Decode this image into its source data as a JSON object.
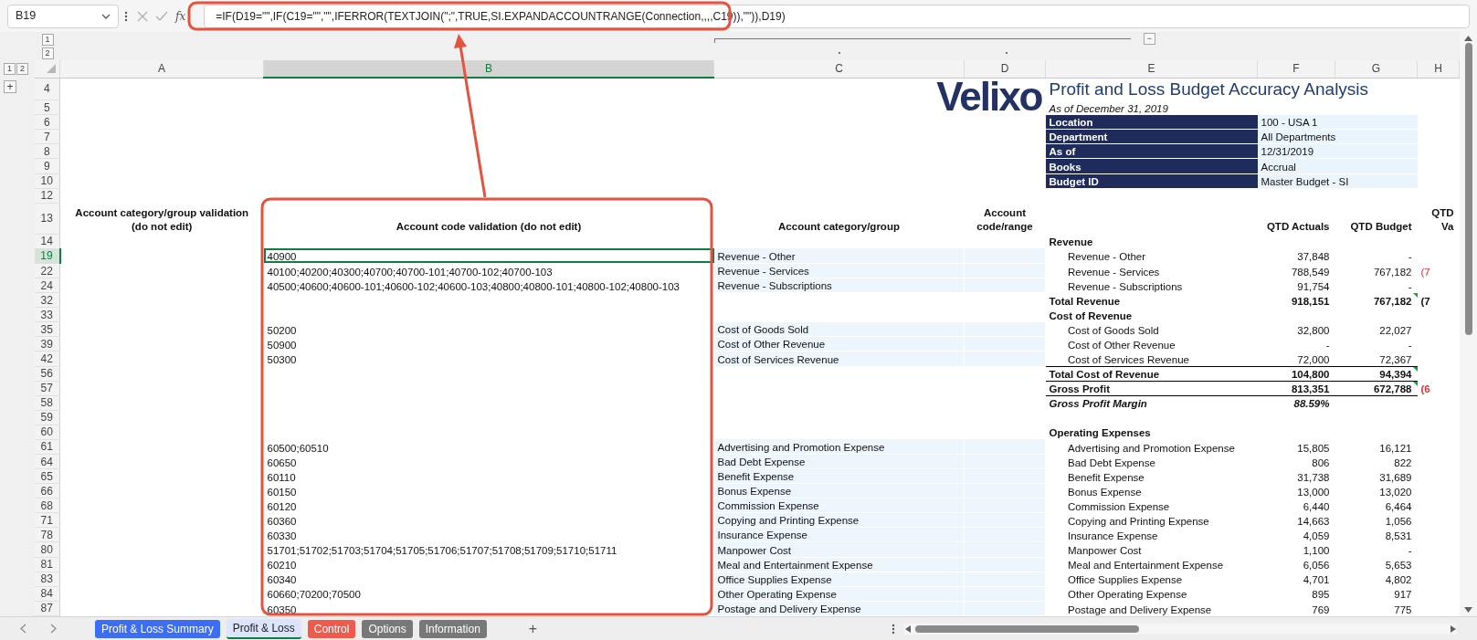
{
  "formula_bar": {
    "cell_ref": "B19",
    "function_label": "fx",
    "formula": "=IF(D19=\"\",IF(C19=\"\",\"\",IFERROR(TEXTJOIN(\";\",TRUE,SI.EXPANDACCOUNTRANGE(Connection,,,,C19)),\"\")),D19)"
  },
  "outline": {
    "column_levels": [
      "1",
      "2"
    ],
    "collapse": "−",
    "row_levels": [
      "1",
      "2"
    ],
    "expand": "+"
  },
  "columns": [
    {
      "label": "A",
      "selected": false
    },
    {
      "label": "B",
      "selected": true
    },
    {
      "label": "C",
      "selected": false
    },
    {
      "label": "D",
      "selected": false
    },
    {
      "label": "E",
      "selected": false
    },
    {
      "label": "F",
      "selected": false
    },
    {
      "label": "G",
      "selected": false
    },
    {
      "label": "H",
      "selected": false
    }
  ],
  "rows": [
    {
      "n": "4",
      "selected": false,
      "flagged": false,
      "logo": "Velixo",
      "title": "Profit and Loss Budget Accuracy Analysis"
    },
    {
      "n": "5",
      "selected": false,
      "flagged": false,
      "subtitle": "As of December 31, 2019"
    },
    {
      "n": "6",
      "selected": false,
      "flagged": false,
      "param_label": "Location",
      "param_value": "100 - USA 1"
    },
    {
      "n": "7",
      "selected": false,
      "flagged": false,
      "param_label": "Department",
      "param_value": "All Departments"
    },
    {
      "n": "8",
      "selected": false,
      "flagged": false,
      "param_label": "As of",
      "param_value": "12/31/2019"
    },
    {
      "n": "9",
      "selected": false,
      "flagged": false,
      "param_label": "Books",
      "param_value": "Accrual"
    },
    {
      "n": "10",
      "selected": false,
      "flagged": false,
      "param_label": "Budget ID",
      "param_value": "Master Budget - SI"
    },
    {
      "n": "12",
      "selected": false,
      "flagged": false
    },
    {
      "n": "13",
      "selected": false,
      "flagged": false,
      "kind": "column-header",
      "a": "Account category/group validation (do not edit)",
      "b": "Account code validation\n(do not edit)",
      "c": "Account category/group",
      "d": "Account code/range",
      "f": "QTD Actuals",
      "g": "QTD Budget",
      "h": "QTD Va"
    },
    {
      "n": "14",
      "selected": false,
      "flagged": false,
      "kind": "section",
      "e": "Revenue"
    },
    {
      "n": "19",
      "selected": true,
      "flagged": false,
      "kind": "item",
      "b": "40900",
      "c": "Revenue - Other",
      "e": "Revenue - Other",
      "f": "37,848",
      "g": "-"
    },
    {
      "n": "22",
      "selected": false,
      "flagged": false,
      "kind": "item",
      "b": "40100;40200;40300;40700;40700-101;40700-102;40700-103",
      "c": "Revenue - Services",
      "e": "Revenue - Services",
      "f": "788,549",
      "g": "767,182",
      "h": "(7",
      "alert": true
    },
    {
      "n": "24",
      "selected": false,
      "flagged": false,
      "kind": "item",
      "b": "40500;40600;40600-101;40600-102;40600-103;40800;40800-101;40800-102;40800-103",
      "c": "Revenue - Subscriptions",
      "e": "Revenue - Subscriptions",
      "f": "91,754",
      "g": "-"
    },
    {
      "n": "32",
      "selected": false,
      "flagged": true,
      "kind": "total",
      "e": "Total Revenue",
      "f": "918,151",
      "g": "767,182",
      "h": "(7",
      "alert": false
    },
    {
      "n": "33",
      "selected": false,
      "flagged": false,
      "kind": "section",
      "e": "Cost of Revenue"
    },
    {
      "n": "35",
      "selected": false,
      "flagged": false,
      "kind": "item",
      "b": "50200",
      "c": "Cost of Goods Sold",
      "e": "Cost of Goods Sold",
      "f": "32,800",
      "g": "22,027"
    },
    {
      "n": "39",
      "selected": false,
      "flagged": false,
      "kind": "item",
      "b": "50900",
      "c": "Cost of Other Revenue",
      "e": "Cost of Other Revenue",
      "f": "-",
      "g": "-"
    },
    {
      "n": "42",
      "selected": false,
      "flagged": false,
      "kind": "item",
      "b": "50300",
      "c": "Cost of Services Revenue",
      "e": "Cost of Services Revenue",
      "f": "72,000",
      "g": "72,367"
    },
    {
      "n": "56",
      "selected": false,
      "flagged": true,
      "kind": "grand-total",
      "e": "Total Cost of Revenue",
      "f": "104,800",
      "g": "94,394"
    },
    {
      "n": "57",
      "selected": false,
      "flagged": true,
      "kind": "grand-total",
      "e": "Gross Profit",
      "f": "813,351",
      "g": "672,788",
      "h": "(6",
      "alert": true
    },
    {
      "n": "58",
      "selected": false,
      "flagged": false,
      "kind": "margin",
      "e": "Gross Profit Margin",
      "f": "88.59%"
    },
    {
      "n": "59",
      "selected": false,
      "flagged": false
    },
    {
      "n": "60",
      "selected": false,
      "flagged": false,
      "kind": "section",
      "e": "Operating Expenses"
    },
    {
      "n": "61",
      "selected": false,
      "flagged": false,
      "kind": "item",
      "b": "60500;60510",
      "c": "Advertising and Promotion Expense",
      "e": "Advertising and Promotion Expense",
      "f": "15,805",
      "g": "16,121"
    },
    {
      "n": "64",
      "selected": false,
      "flagged": false,
      "kind": "item",
      "b": "60650",
      "c": "Bad Debt Expense",
      "e": "Bad Debt Expense",
      "f": "806",
      "g": "822"
    },
    {
      "n": "65",
      "selected": false,
      "flagged": false,
      "kind": "item",
      "b": "60110",
      "c": "Benefit Expense",
      "e": "Benefit Expense",
      "f": "31,738",
      "g": "31,689"
    },
    {
      "n": "66",
      "selected": false,
      "flagged": false,
      "kind": "item",
      "b": "60150",
      "c": "Bonus Expense",
      "e": "Bonus Expense",
      "f": "13,000",
      "g": "13,020"
    },
    {
      "n": "68",
      "selected": false,
      "flagged": false,
      "kind": "item",
      "b": "60120",
      "c": "Commission Expense",
      "e": "Commission Expense",
      "f": "6,440",
      "g": "6,464"
    },
    {
      "n": "71",
      "selected": false,
      "flagged": false,
      "kind": "item",
      "b": "60360",
      "c": "Copying and Printing Expense",
      "e": "Copying and Printing Expense",
      "f": "14,663",
      "g": "1,056"
    },
    {
      "n": "78",
      "selected": false,
      "flagged": false,
      "kind": "item",
      "b": "60330",
      "c": "Insurance Expense",
      "e": "Insurance Expense",
      "f": "4,059",
      "g": "8,531"
    },
    {
      "n": "80",
      "selected": false,
      "flagged": false,
      "kind": "item",
      "b": "51701;51702;51703;51704;51705;51706;51707;51708;51709;51710;51711",
      "c": "Manpower Cost",
      "e": "Manpower Cost",
      "f": "1,100",
      "g": "-"
    },
    {
      "n": "81",
      "selected": false,
      "flagged": false,
      "kind": "item",
      "b": "60210",
      "c": "Meal and Entertainment Expense",
      "e": "Meal and Entertainment Expense",
      "f": "6,056",
      "g": "5,653"
    },
    {
      "n": "83",
      "selected": false,
      "flagged": false,
      "kind": "item",
      "b": "60340",
      "c": "Office Supplies Expense",
      "e": "Office Supplies Expense",
      "f": "4,701",
      "g": "4,802"
    },
    {
      "n": "84",
      "selected": false,
      "flagged": false,
      "kind": "item",
      "b": "60660;70200;70500",
      "c": "Other Operating Expense",
      "e": "Other Operating Expense",
      "f": "895",
      "g": "917"
    },
    {
      "n": "87",
      "selected": false,
      "flagged": false,
      "kind": "item",
      "b": "60350",
      "c": "Postage and Delivery Expense",
      "e": "Postage and Delivery Expense",
      "f": "769",
      "g": "775"
    }
  ],
  "sheet_tabs": [
    {
      "label": "Profit & Loss Summary",
      "color": "#3b6ef5",
      "selected": false
    },
    {
      "label": "Profit & Loss",
      "color": "#dce5fb",
      "selected": true
    },
    {
      "label": "Control",
      "color": "#ef5a4d",
      "selected": false
    },
    {
      "label": "Options",
      "color": "#787878",
      "selected": false
    },
    {
      "label": "Information",
      "color": "#787878",
      "selected": false
    }
  ],
  "add_sheet": "+"
}
